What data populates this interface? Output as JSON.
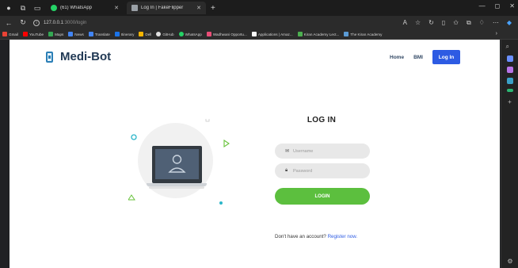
{
  "browser": {
    "tabs": [
      {
        "label": "(61) WhatsApp",
        "icon": "whatsapp-icon",
        "color": "#25d366",
        "active": false
      },
      {
        "label": "Log In | FakeFlipper",
        "icon": "page-icon",
        "color": "#9aa0a6",
        "active": true
      }
    ],
    "url_host": "127.0.0.1",
    "url_path": ":3000/login",
    "bookmarks": [
      {
        "label": "Gmail",
        "color": "#ea4335"
      },
      {
        "label": "YouTube",
        "color": "#ff0000"
      },
      {
        "label": "Maps",
        "color": "#34a853"
      },
      {
        "label": "News",
        "color": "#4285f4"
      },
      {
        "label": "Translate",
        "color": "#4285f4"
      },
      {
        "label": "Itinerary",
        "color": "#1a73e8"
      },
      {
        "label": "Dell",
        "color": "#f4b400"
      },
      {
        "label": "GitHub",
        "color": "#e0e0e0"
      },
      {
        "label": "WhatsApp",
        "color": "#25d366"
      },
      {
        "label": "Wadhwani Opportu...",
        "color": "#e94e77"
      },
      {
        "label": "Applications | Amaz...",
        "color": "#f9f9f9"
      },
      {
        "label": "Kiran Academy Lect...",
        "color": "#4caf50"
      },
      {
        "label": "The Kiran Academy",
        "color": "#5b9bd5"
      }
    ]
  },
  "page": {
    "brand": "Medi-Bot",
    "nav": {
      "home": "Home",
      "bmi": "BMI",
      "login": "Log In"
    },
    "form": {
      "title": "LOG IN",
      "username_placeholder": "Username",
      "password_placeholder": "Password",
      "submit": "LOGIN",
      "register_prompt": "Don't have an account?",
      "register_link": "Register now."
    },
    "colors": {
      "accent": "#2d5be3",
      "login_green": "#5cbf3e",
      "brand_text": "#223a55"
    }
  }
}
